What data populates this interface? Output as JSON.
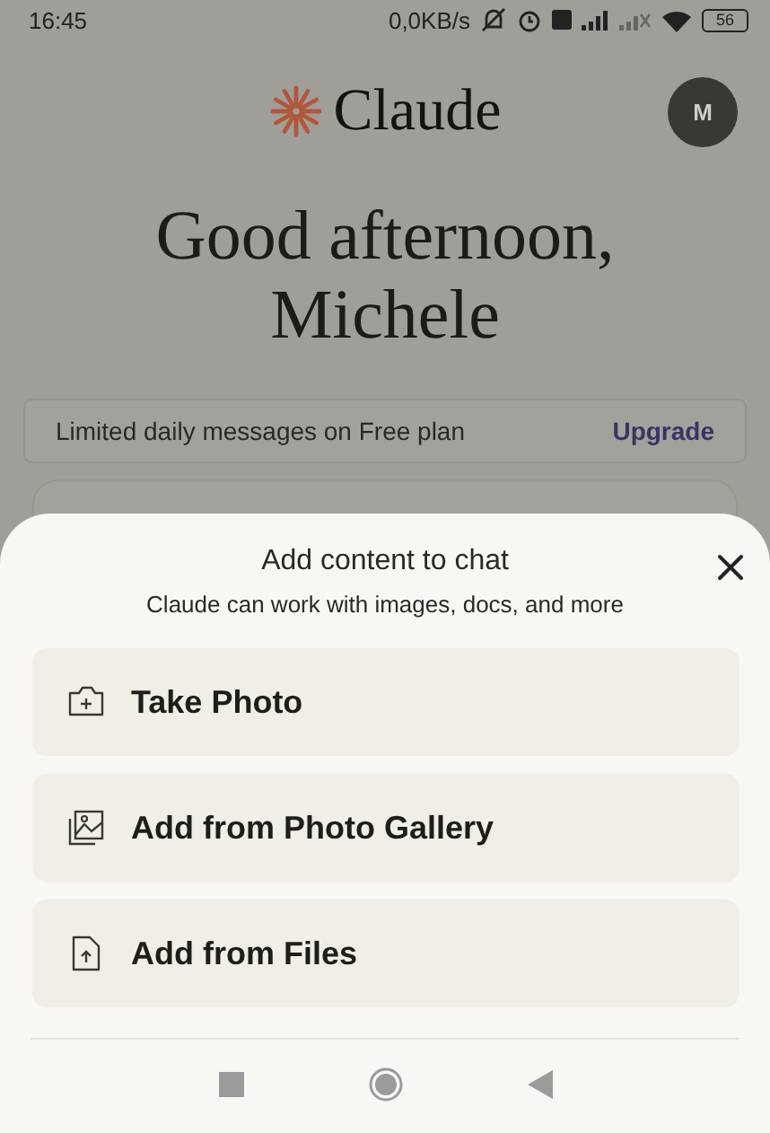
{
  "status_bar": {
    "time": "16:45",
    "network_speed": "0,0KB/s",
    "battery": "56"
  },
  "header": {
    "logo_text": "Claude",
    "avatar_initial": "M"
  },
  "greeting": "Good afternoon, Michele",
  "banner": {
    "text": "Limited daily messages on Free plan",
    "action": "Upgrade"
  },
  "sheet": {
    "title": "Add content to chat",
    "subtitle": "Claude can work with images, docs, and more",
    "options": [
      {
        "kind": "camera",
        "label": "Take Photo"
      },
      {
        "kind": "gallery",
        "label": "Add from Photo Gallery"
      },
      {
        "kind": "file",
        "label": "Add from Files"
      }
    ]
  }
}
